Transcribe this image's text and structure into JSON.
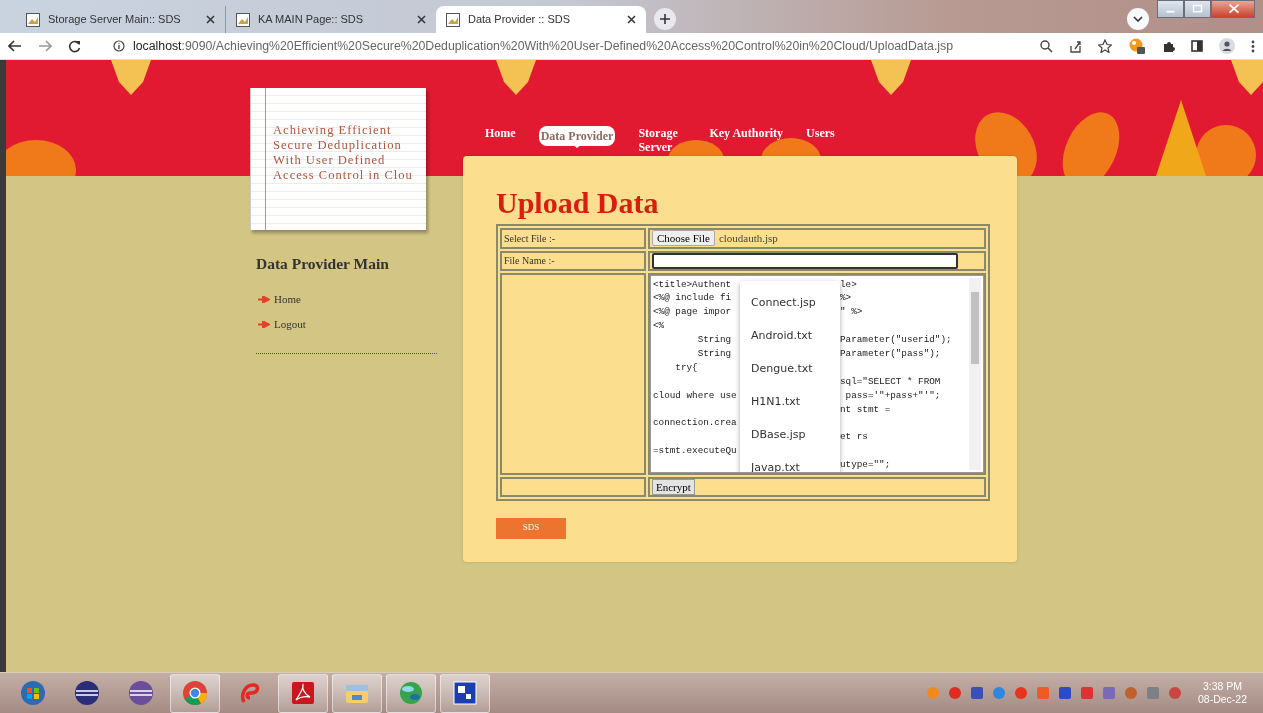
{
  "browser": {
    "tabs": [
      {
        "title": "Storage Server Main:: SDS",
        "selected": false
      },
      {
        "title": "KA MAIN Page:: SDS",
        "selected": false
      },
      {
        "title": "Data Provider :: SDS",
        "selected": true
      }
    ],
    "address": {
      "host": "localhost",
      "path": ":9090/Achieving%20Efficient%20Secure%20Deduplication%20With%20User-Defined%20Access%20Control%20in%20Cloud/UploadData.jsp"
    }
  },
  "page": {
    "logo_lines": [
      "Achieving Efficient",
      "Secure Deduplication",
      "With User Defined",
      "Access Control in Clou"
    ],
    "nav": [
      {
        "label": "Home",
        "selected": false
      },
      {
        "label": "Data Provider",
        "selected": true
      },
      {
        "label": "Storage Server",
        "selected": false
      },
      {
        "label": "Key Authority",
        "selected": false
      },
      {
        "label": "Users",
        "selected": false
      }
    ],
    "sidebar": {
      "title": "Data Provider Main",
      "links": [
        "Home",
        "Logout"
      ]
    },
    "panel": {
      "title": "Upload Data",
      "select_file": {
        "label": "Select File :-",
        "button": "Choose File",
        "file": "cloudauth.jsp"
      },
      "file_name": {
        "label": "File Name :-"
      },
      "code_lines": [
        {
          "left": "<title>Authent",
          "right": "le>"
        },
        {
          "left": "<%@ include fi",
          "right": "%>"
        },
        {
          "left": "<%@ page impor",
          "right": "\" %>"
        },
        {
          "left": "<%"
        },
        {
          "left": "        String",
          "right": "Parameter(\"userid\");"
        },
        {
          "left": "        String",
          "right": "Parameter(\"pass\");"
        },
        {
          "left": "    try{"
        },
        {
          "right": "sql=\"SELECT * FROM"
        },
        {
          "left": "cloud where use",
          "right": " pass='\"+pass+\"'\";"
        },
        {
          "right": "nt stmt ="
        },
        {
          "left": "connection.crea"
        },
        {
          "right": "et rs"
        },
        {
          "left": "=stmt.executeQu"
        },
        {
          "right": "utype=\"\";"
        }
      ],
      "suggestions": [
        "Connect.jsp",
        "Android.txt",
        "Dengue.txt",
        "H1N1.txt",
        "DBase.jsp",
        "Javap.txt"
      ],
      "encrypt_button": "Encrypt",
      "sds_button": "SDS"
    }
  },
  "taskbar": {
    "apps": [
      {
        "kind": "start",
        "running": false
      },
      {
        "kind": "eclipse",
        "running": false
      },
      {
        "kind": "eclipse-purple",
        "running": false
      },
      {
        "kind": "chrome",
        "running": true
      },
      {
        "kind": "swirl",
        "running": false
      },
      {
        "kind": "acrobat",
        "running": true
      },
      {
        "kind": "explorer",
        "running": true
      },
      {
        "kind": "green-ball",
        "running": true
      },
      {
        "kind": "blue-app",
        "running": true
      }
    ],
    "time": "3:38 PM",
    "date": "08-Dec-22"
  }
}
